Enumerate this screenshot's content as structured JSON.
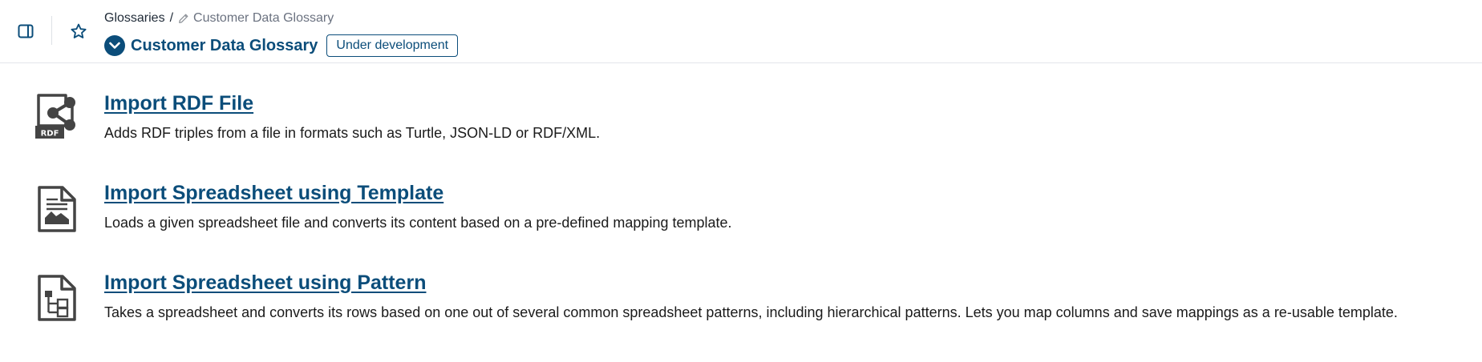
{
  "header": {
    "sidebar_toggle_icon": "sidebar-panel-icon",
    "favorite_icon": "star-outline-icon",
    "breadcrumb": {
      "parent": "Glossaries",
      "separator": "/",
      "current": "Customer Data Glossary",
      "current_icon": "pencil-icon"
    },
    "title": "Customer Data Glossary",
    "title_icon": "chevron-down-circle-icon",
    "status_badge": "Under development"
  },
  "options": [
    {
      "icon": "rdf-share-icon",
      "icon_label": "RDF",
      "title": "Import RDF File",
      "description": "Adds RDF triples from a file in formats such as Turtle, JSON-LD or RDF/XML."
    },
    {
      "icon": "spreadsheet-chart-document-icon",
      "title": "Import Spreadsheet using Template",
      "description": "Loads a given spreadsheet file and converts its content based on a pre-defined mapping template."
    },
    {
      "icon": "spreadsheet-hierarchy-document-icon",
      "title": "Import Spreadsheet using Pattern",
      "description": "Takes a spreadsheet and converts its rows based on one out of several common spreadsheet patterns, including hierarchical patterns. Lets you map columns and save mappings as a re-usable template."
    }
  ],
  "colors": {
    "brand": "#0b4d7a",
    "text": "#1a1a1a",
    "muted": "#6b7280",
    "icon": "#444444",
    "divider": "#e3e6ea"
  }
}
